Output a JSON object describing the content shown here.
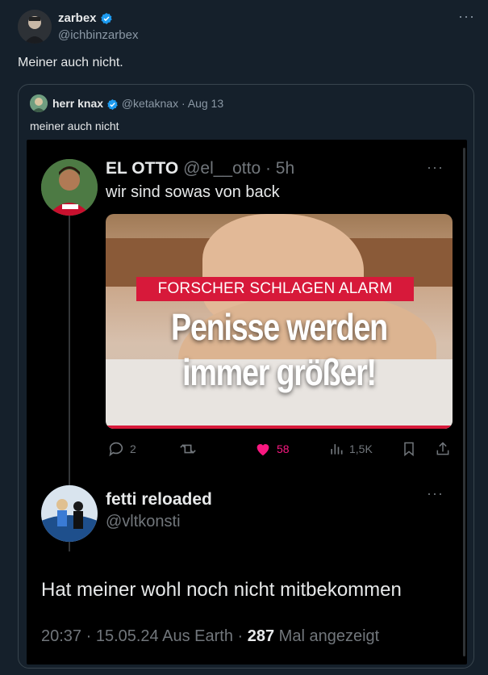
{
  "tweet": {
    "author_name": "zarbex",
    "author_handle": "@ichbinzarbex",
    "more_label": "···",
    "text": "Meiner auch nicht."
  },
  "quote": {
    "author_name": "herr knax",
    "author_handle": "@ketaknax",
    "date": "· Aug 13",
    "text": "meiner auch nicht"
  },
  "screenshot": {
    "post": {
      "author_name": "EL OTTO",
      "author_handle": "@el__otto",
      "time": "· 5h",
      "text": "wir sind sowas von back",
      "more_label": "···",
      "media": {
        "banner": "FORSCHER SCHLAGEN ALARM",
        "headline_line1": "Penisse werden",
        "headline_line2": "immer größer!"
      },
      "actions": {
        "replies": "2",
        "likes": "58",
        "views": "1,5K"
      }
    },
    "reply": {
      "author_name": "fetti reloaded",
      "author_handle": "@vltkonsti",
      "more_label": "···",
      "text": "Hat meiner wohl noch nicht mitbekommen",
      "meta_time": "20:37 · 15.05.24 Aus Earth ·",
      "meta_views_count": "287",
      "meta_views_label": "Mal angezeigt"
    }
  },
  "colors": {
    "background": "#15202b",
    "verified": "#1d9bf0",
    "like": "#f91880",
    "muted": "#8b98a5",
    "banner_red": "#d7193a"
  }
}
